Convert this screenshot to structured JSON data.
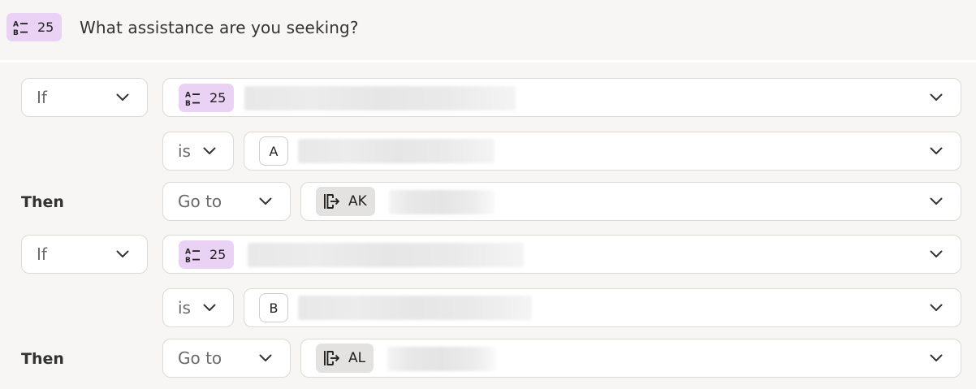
{
  "header": {
    "question_number": "25",
    "question_title": "What assistance are you seeking?",
    "icon": "multiple-choice-ab-icon"
  },
  "rules": [
    {
      "condition_label": "If",
      "question_number": "25",
      "operator_label": "is",
      "choice_letter": "A",
      "then_label": "Then",
      "action_label": "Go to",
      "target_id": "AK",
      "target_icon": "jump-to-icon"
    },
    {
      "condition_label": "If",
      "question_number": "25",
      "operator_label": "is",
      "choice_letter": "B",
      "then_label": "Then",
      "action_label": "Go to",
      "target_id": "AL",
      "target_icon": "jump-to-icon"
    }
  ],
  "colors": {
    "page_bg": "#f7f6f4",
    "question_badge": "#e9d2f4",
    "goto_badge": "#e3e2e0",
    "field_border": "#dcdad6"
  }
}
